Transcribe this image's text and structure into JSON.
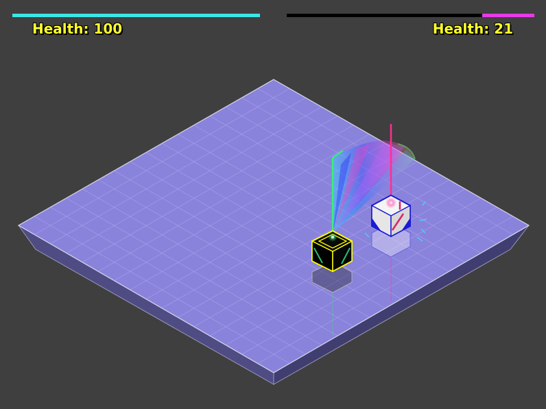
{
  "players": [
    {
      "id": "player1",
      "health_label": "Health: 100",
      "health": 100,
      "max_health": 100,
      "bar_color": "#3ee6e6"
    },
    {
      "id": "player2",
      "health_label": "Health: 21",
      "health": 21,
      "max_health": 100,
      "bar_color": "#e83ae8"
    }
  ],
  "colors": {
    "background": "#3f3f3f",
    "board_top": "#8a83dc",
    "board_side": "#4f4c84",
    "label_text": "#ffff2a",
    "player_cube_outline": "#ffff00",
    "player_laser": "#39f07a",
    "enemy_cube_outline": "#1a1ad6",
    "enemy_laser": "#ff2f8f"
  },
  "icons": {
    "player_unit": "black-cube-icon",
    "enemy_unit": "white-cube-icon"
  }
}
